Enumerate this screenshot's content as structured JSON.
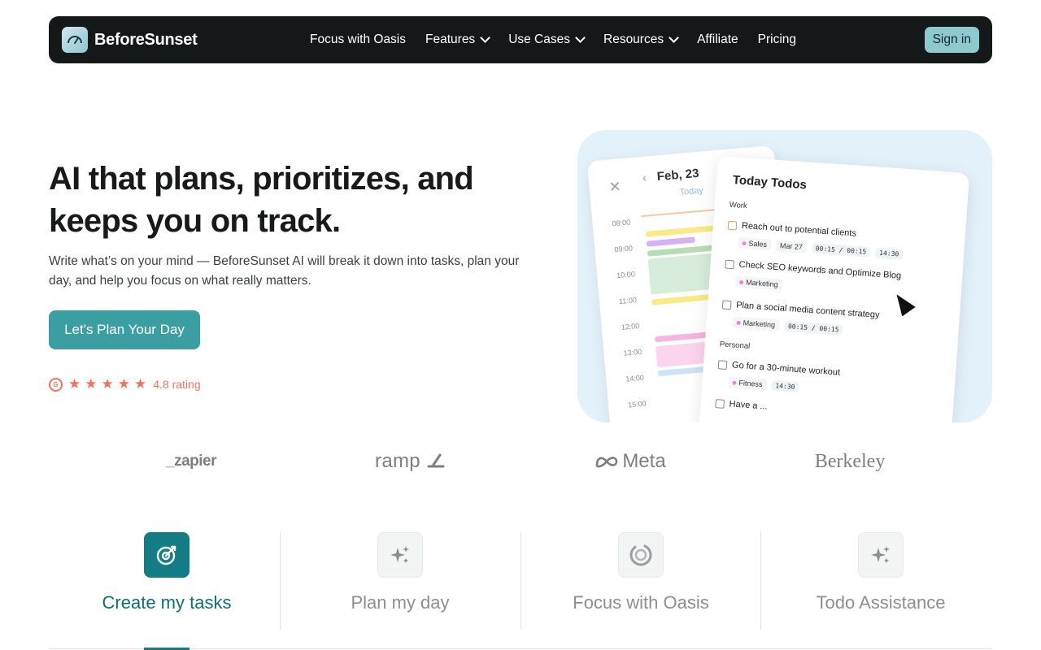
{
  "nav": {
    "brand": "BeforeSunset",
    "links": [
      {
        "label": "Focus with Oasis",
        "dropdown": false
      },
      {
        "label": "Features",
        "dropdown": true
      },
      {
        "label": "Use Cases",
        "dropdown": true
      },
      {
        "label": "Resources",
        "dropdown": true
      },
      {
        "label": "Affiliate",
        "dropdown": false
      },
      {
        "label": "Pricing",
        "dropdown": false
      }
    ],
    "signin": "Sign in"
  },
  "hero": {
    "title_line1": "AI that plans, prioritizes, and",
    "title_line2": "keeps you on track.",
    "subtitle": "Write what’s on your mind — BeforeSunset AI will break it down into tasks, plan your day, and help you focus on what really matters.",
    "cta": "Let's Plan Your Day",
    "rating": {
      "stars": 5,
      "text": "4.8 rating",
      "badge": "G"
    }
  },
  "hero_image": {
    "calendar": {
      "date": "Feb, 23",
      "today": "Today",
      "hours": [
        "08:00",
        "09:00",
        "10:00",
        "11:00",
        "12:00",
        "13:00",
        "14:00",
        "15:00"
      ]
    },
    "todos": {
      "title": "Today Todos",
      "groups": [
        {
          "name": "Work",
          "items": [
            {
              "text": "Reach out to potential clients",
              "tag": "Sales",
              "date": "Mar 27",
              "time1": "00:15 / 00:15",
              "time2": "14:30"
            },
            {
              "text": "Check SEO keywords and Optimize Blog",
              "tag": "Marketing"
            },
            {
              "text": "Plan a social media content strategy",
              "tag": "Marketing",
              "time1": "00:15 / 00:15"
            }
          ]
        },
        {
          "name": "Personal",
          "items": [
            {
              "text": "Go for a 30-minute workout",
              "tag": "Fitness",
              "time2": "14:30"
            },
            {
              "text": "Have a ..."
            }
          ]
        }
      ]
    }
  },
  "logos": [
    "_zapier",
    "ramp",
    "Meta",
    "Berkeley"
  ],
  "feature_tabs": [
    {
      "label": "Create my tasks",
      "icon": "target-icon",
      "active": true
    },
    {
      "label": "Plan my day",
      "icon": "sparkles-icon",
      "active": false
    },
    {
      "label": "Focus with Oasis",
      "icon": "focus-ring-icon",
      "active": false
    },
    {
      "label": "Todo Assistance",
      "icon": "sparkles-icon",
      "active": false
    }
  ],
  "colors": {
    "nav_bg": "#141819",
    "accent": "#3b9ea3",
    "accent_dark": "#137c84",
    "rating": "#f0735a",
    "hero_img_bg": "#e3f1fb"
  }
}
